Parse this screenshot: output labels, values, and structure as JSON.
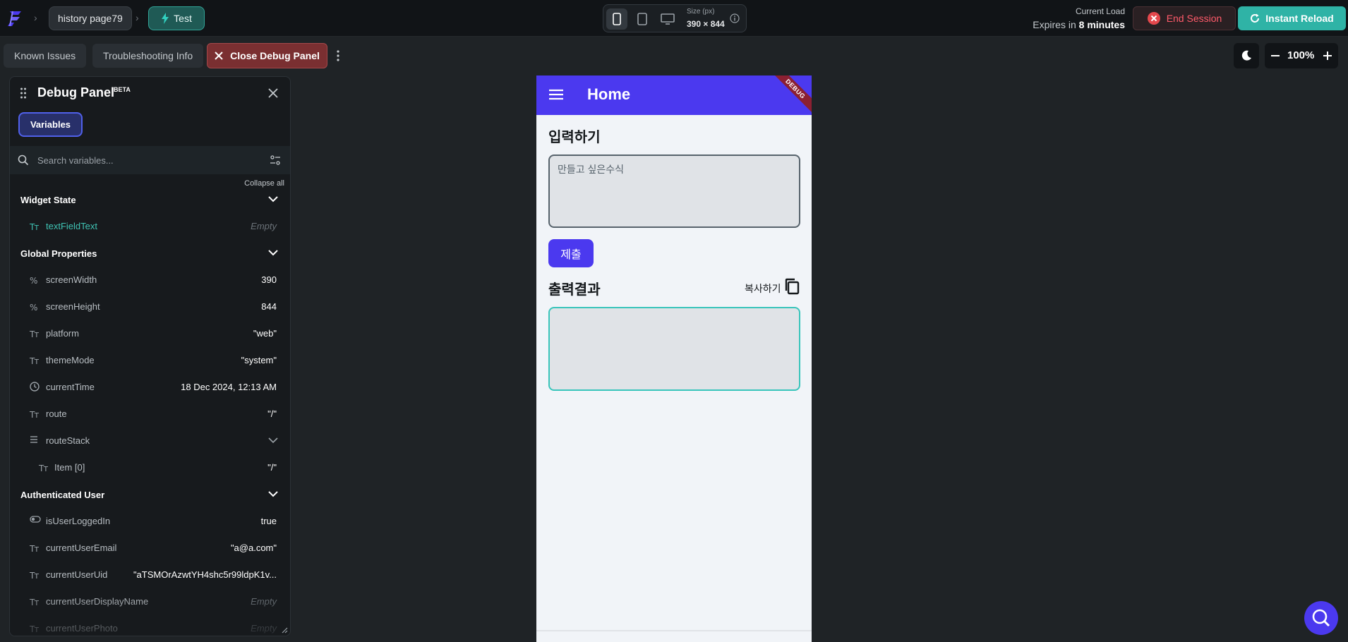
{
  "topbar": {
    "page_name": "history page79",
    "mode_label": "Test",
    "size_label": "Size (px)",
    "size_value": "390 × 844",
    "load_label": "Current Load",
    "expires_prefix": "Expires in",
    "expires_value": "8 minutes",
    "end_session_label": "End Session",
    "instant_reload_label": "Instant Reload"
  },
  "toolbar": {
    "known_issues_label": "Known Issues",
    "troubleshooting_label": "Troubleshooting Info",
    "close_debug_label": "Close Debug Panel",
    "zoom_value": "100%"
  },
  "debug_panel": {
    "title": "Debug Panel",
    "badge": "BETA",
    "tab_variables": "Variables",
    "search_placeholder": "Search variables...",
    "collapse_all": "Collapse all",
    "sections": {
      "widget_state": "Widget State",
      "global_properties": "Global Properties",
      "authenticated_user": "Authenticated User"
    },
    "widget_state": [
      {
        "name": "textFieldText",
        "value": "Empty",
        "icon": "text-type-icon"
      }
    ],
    "global_properties": [
      {
        "name": "screenWidth",
        "value": "390",
        "icon": "percent-icon"
      },
      {
        "name": "screenHeight",
        "value": "844",
        "icon": "percent-icon"
      },
      {
        "name": "platform",
        "value": "\"web\"",
        "icon": "text-type-icon"
      },
      {
        "name": "themeMode",
        "value": "\"system\"",
        "icon": "text-type-icon"
      },
      {
        "name": "currentTime",
        "value": "18 Dec 2024, 12:13 AM",
        "icon": "clock-icon"
      },
      {
        "name": "route",
        "value": "\"/\"",
        "icon": "text-type-icon"
      },
      {
        "name": "routeStack",
        "value": "",
        "icon": "list-icon"
      },
      {
        "name": "Item [0]",
        "value": "\"/\"",
        "icon": "text-type-icon"
      }
    ],
    "authenticated_user": [
      {
        "name": "isUserLoggedIn",
        "value": "true",
        "icon": "toggle-icon"
      },
      {
        "name": "currentUserEmail",
        "value": "\"a@a.com\"",
        "icon": "text-type-icon"
      },
      {
        "name": "currentUserUid",
        "value": "\"aTSMOrAzwtYH4shc5r99ldpK1v...",
        "icon": "text-type-icon"
      },
      {
        "name": "currentUserDisplayName",
        "value": "Empty",
        "icon": "text-type-icon"
      },
      {
        "name": "currentUserPhoto",
        "value": "Empty",
        "icon": "text-type-icon"
      }
    ]
  },
  "app": {
    "title": "Home",
    "debug_ribbon": "DEBUG",
    "input_heading": "입력하기",
    "input_placeholder": "만들고 싶은수식",
    "submit_label": "제출",
    "output_heading": "출력결과",
    "copy_label": "복사하기"
  },
  "colors": {
    "primary": "#4b39ef",
    "teal": "#39c5bb",
    "danger": "#ff5a6a",
    "reload": "#2fb3a6"
  }
}
